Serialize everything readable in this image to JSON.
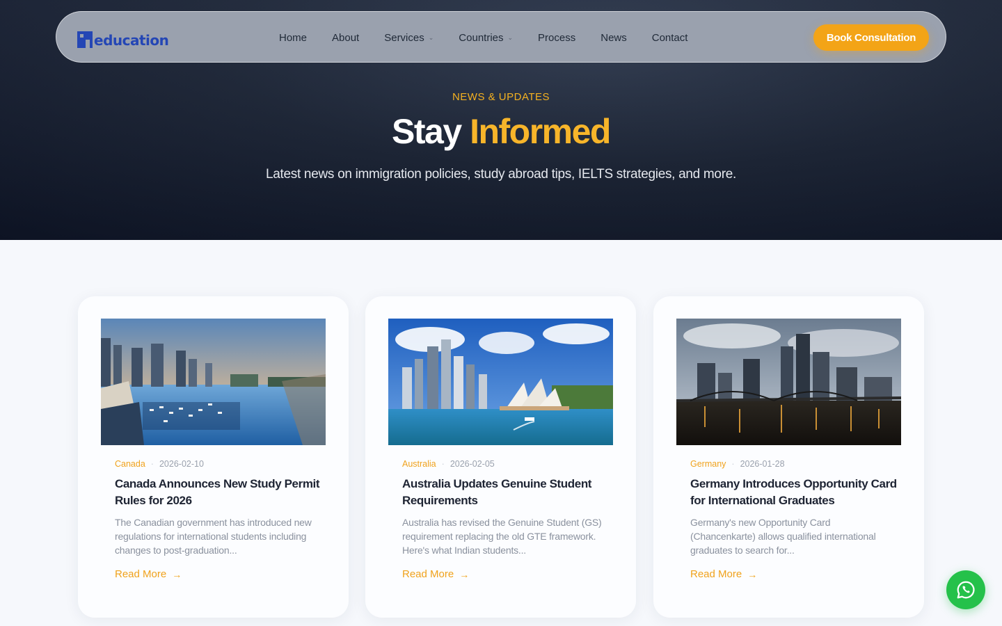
{
  "nav": {
    "logo_text": "education",
    "items": [
      {
        "label": "Home",
        "has_dropdown": false
      },
      {
        "label": "About",
        "has_dropdown": false
      },
      {
        "label": "Services",
        "has_dropdown": true
      },
      {
        "label": "Countries",
        "has_dropdown": true
      },
      {
        "label": "Process",
        "has_dropdown": false
      },
      {
        "label": "News",
        "has_dropdown": false
      },
      {
        "label": "Contact",
        "has_dropdown": false
      }
    ],
    "cta_label": "Book Consultation"
  },
  "hero": {
    "eyebrow": "NEWS & UPDATES",
    "title_plain": "Stay",
    "title_accent": "Informed",
    "subtitle": "Latest news on immigration policies, study abroad tips, IELTS strategies, and more."
  },
  "articles": [
    {
      "category": "Canada",
      "date": "2026-02-10",
      "title": "Canada Announces New Study Permit Rules for 2026",
      "excerpt": "The Canadian government has introduced new regulations for international students including changes to post-graduation...",
      "read_more": "Read More",
      "image": "vancouver-harbor-photo"
    },
    {
      "category": "Australia",
      "date": "2026-02-05",
      "title": "Australia Updates Genuine Student Requirements",
      "excerpt": "Australia has revised the Genuine Student (GS) requirement replacing the old GTE framework. Here's what Indian students...",
      "read_more": "Read More",
      "image": "sydney-opera-house-photo"
    },
    {
      "category": "Germany",
      "date": "2026-01-28",
      "title": "Germany Introduces Opportunity Card for International Graduates",
      "excerpt": "Germany's new Opportunity Card (Chancenkarte) allows qualified international graduates to search for...",
      "read_more": "Read More",
      "image": "frankfurt-skyline-photo"
    }
  ],
  "colors": {
    "accent": "#f3a417",
    "brand_blue": "#2446b5",
    "hero_bg": "#1d2638",
    "whatsapp": "#25c14a"
  },
  "icons": {
    "dropdown": "chevron-down-icon",
    "read_more": "arrow-right-icon",
    "floating": "whatsapp-icon"
  }
}
